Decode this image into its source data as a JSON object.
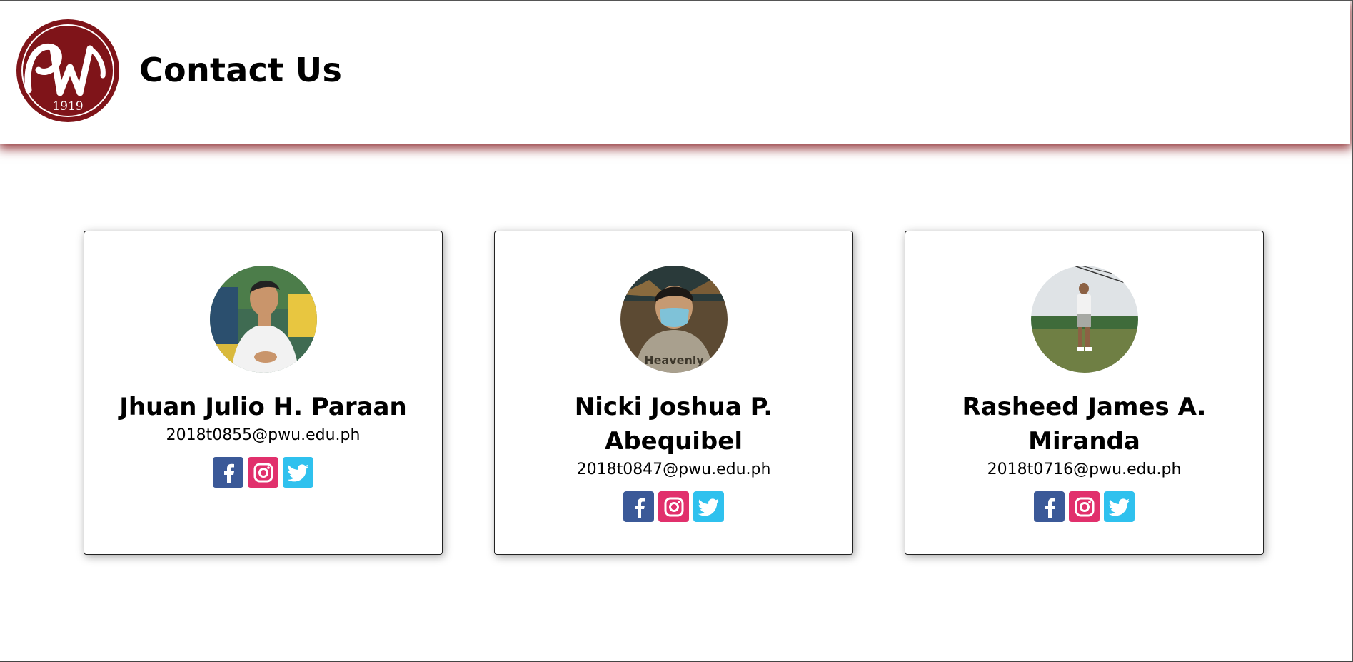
{
  "header": {
    "title": "Contact Us",
    "logo_text": "1919",
    "logo_icon": "university-seal-logo"
  },
  "contacts": [
    {
      "name": "Jhuan Julio H. Paraan",
      "email": "2018t0855@pwu.edu.ph",
      "socials": [
        "facebook-icon",
        "instagram-icon",
        "twitter-icon"
      ]
    },
    {
      "name": "Nicki Joshua P. Abequibel",
      "email": "2018t0847@pwu.edu.ph",
      "socials": [
        "facebook-icon",
        "instagram-icon",
        "twitter-icon"
      ]
    },
    {
      "name": "Rasheed James A. Miranda",
      "email": "2018t0716@pwu.edu.ph",
      "socials": [
        "facebook-icon",
        "instagram-icon",
        "twitter-icon"
      ]
    }
  ],
  "colors": {
    "brand": "#7f1419",
    "facebook": "#3b5998",
    "instagram": "#e1306c",
    "twitter": "#2fc1ee"
  }
}
